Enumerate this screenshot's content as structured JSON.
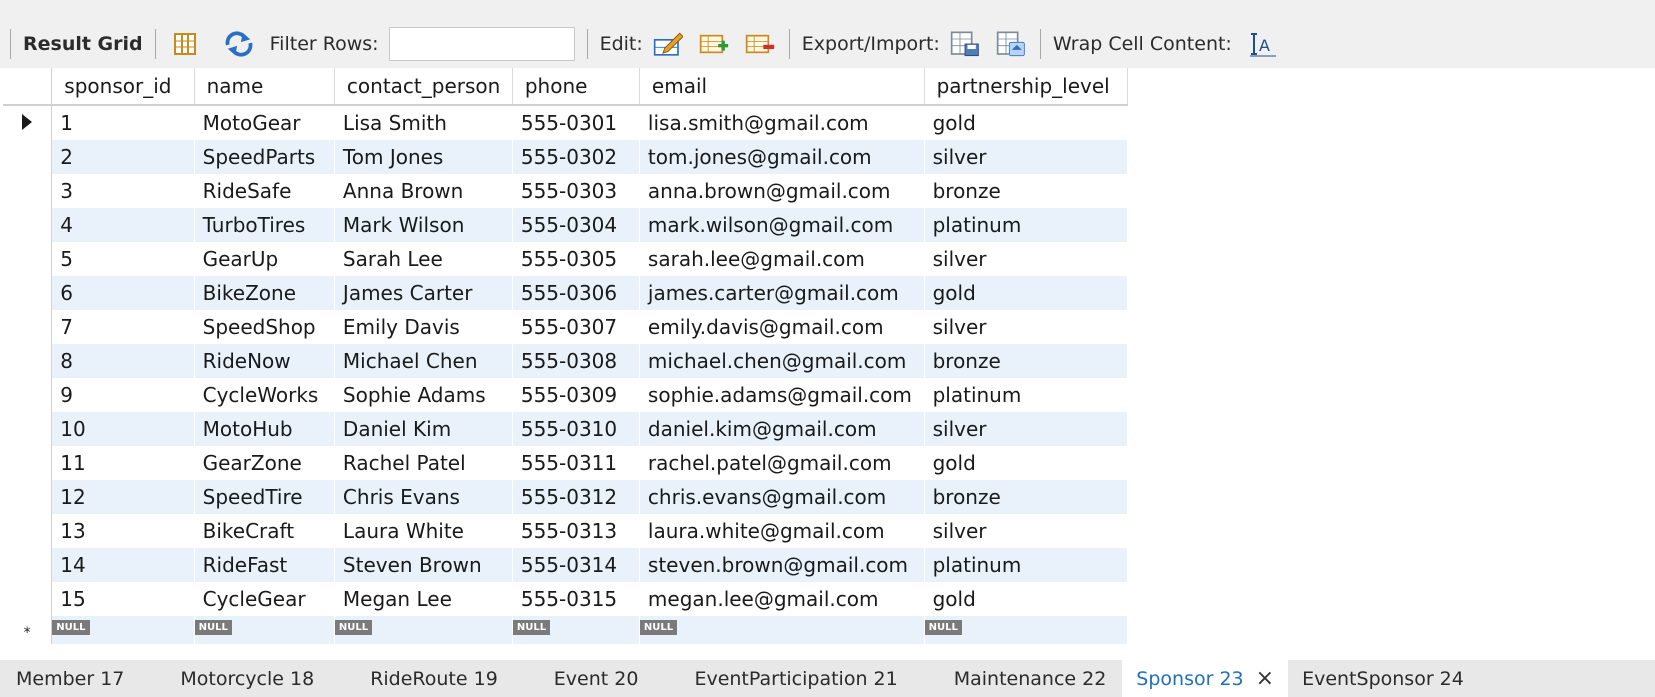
{
  "toolbar": {
    "result_grid": "Result Grid",
    "filter_rows": "Filter Rows:",
    "filter_value": "",
    "edit": "Edit:",
    "export_import": "Export/Import:",
    "wrap_cell": "Wrap Cell Content:"
  },
  "grid": {
    "columns": [
      "sponsor_id",
      "name",
      "contact_person",
      "phone",
      "email",
      "partnership_level"
    ],
    "rows": [
      [
        "1",
        "MotoGear",
        "Lisa Smith",
        "555-0301",
        "lisa.smith@gmail.com",
        "gold"
      ],
      [
        "2",
        "SpeedParts",
        "Tom Jones",
        "555-0302",
        "tom.jones@gmail.com",
        "silver"
      ],
      [
        "3",
        "RideSafe",
        "Anna Brown",
        "555-0303",
        "anna.brown@gmail.com",
        "bronze"
      ],
      [
        "4",
        "TurboTires",
        "Mark Wilson",
        "555-0304",
        "mark.wilson@gmail.com",
        "platinum"
      ],
      [
        "5",
        "GearUp",
        "Sarah Lee",
        "555-0305",
        "sarah.lee@gmail.com",
        "silver"
      ],
      [
        "6",
        "BikeZone",
        "James Carter",
        "555-0306",
        "james.carter@gmail.com",
        "gold"
      ],
      [
        "7",
        "SpeedShop",
        "Emily Davis",
        "555-0307",
        "emily.davis@gmail.com",
        "silver"
      ],
      [
        "8",
        "RideNow",
        "Michael Chen",
        "555-0308",
        "michael.chen@gmail.com",
        "bronze"
      ],
      [
        "9",
        "CycleWorks",
        "Sophie Adams",
        "555-0309",
        "sophie.adams@gmail.com",
        "platinum"
      ],
      [
        "10",
        "MotoHub",
        "Daniel Kim",
        "555-0310",
        "daniel.kim@gmail.com",
        "silver"
      ],
      [
        "11",
        "GearZone",
        "Rachel Patel",
        "555-0311",
        "rachel.patel@gmail.com",
        "gold"
      ],
      [
        "12",
        "SpeedTire",
        "Chris Evans",
        "555-0312",
        "chris.evans@gmail.com",
        "bronze"
      ],
      [
        "13",
        "BikeCraft",
        "Laura White",
        "555-0313",
        "laura.white@gmail.com",
        "silver"
      ],
      [
        "14",
        "RideFast",
        "Steven Brown",
        "555-0314",
        "steven.brown@gmail.com",
        "platinum"
      ],
      [
        "15",
        "CycleGear",
        "Megan Lee",
        "555-0315",
        "megan.lee@gmail.com",
        "gold"
      ]
    ],
    "null_label": "NULL",
    "new_row_marker": "*",
    "new_row_null_columns": [
      0,
      1,
      2,
      3,
      4,
      5
    ]
  },
  "tabs": [
    {
      "label": "Member 17",
      "active": false
    },
    {
      "label": "Motorcycle 18",
      "active": false
    },
    {
      "label": "RideRoute 19",
      "active": false
    },
    {
      "label": "Event 20",
      "active": false
    },
    {
      "label": "EventParticipation 21",
      "active": false
    },
    {
      "label": "Maintenance 22",
      "active": false
    },
    {
      "label": "Sponsor 23",
      "active": true
    },
    {
      "label": "EventSponsor 24",
      "active": false
    }
  ],
  "tab_close_glyph": "×",
  "colors": {
    "accent": "#1f6fbf",
    "alt_row": "#e9f1fb",
    "toolbar_bg": "#f0f0f0"
  }
}
